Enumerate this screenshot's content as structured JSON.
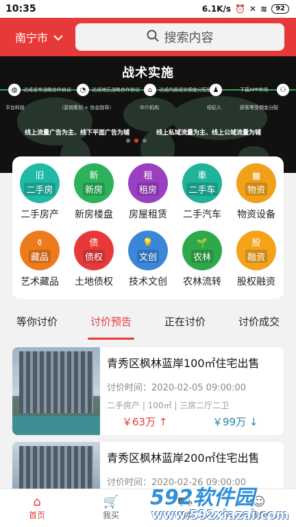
{
  "status": {
    "time": "10:35",
    "speed": "6.1K/s",
    "battery": "92"
  },
  "header": {
    "city": "南宁市",
    "search_placeholder": "搜索内容"
  },
  "banner": {
    "title": "战术实施",
    "nodes": [
      {
        "caption": "达成省市战略合作协议",
        "sub": "平台科技"
      },
      {
        "caption": "达成地区战略合作协议",
        "sub": "（营销策划 + 协会指导）"
      },
      {
        "caption": "达成内部成交佣金分配协议",
        "sub": "中介机构"
      },
      {
        "caption": "",
        "sub": "经纪人"
      },
      {
        "caption": "下载APP市场",
        "sub": "获客等受佣金分配"
      }
    ],
    "slogan_left": "线上流量广告为主、线下平面广告为辅",
    "slogan_right": "线上私域流量为主、线上公域流量为辅"
  },
  "categories": [
    {
      "label": "二手房产",
      "tag": "二手房",
      "glyph": "旧",
      "color": "#20b9a6"
    },
    {
      "label": "新房楼盘",
      "tag": "新房",
      "glyph": "新",
      "color": "#2bb25a"
    },
    {
      "label": "房屋租赁",
      "tag": "租房",
      "glyph": "租",
      "color": "#9a3fc2"
    },
    {
      "label": "二手汽车",
      "tag": "二手车",
      "glyph": "車",
      "color": "#1fb39a"
    },
    {
      "label": "物资设备",
      "tag": "物资",
      "glyph": "▦",
      "color": "#f0a019"
    },
    {
      "label": "艺术藏品",
      "tag": "藏品",
      "glyph": "⚱",
      "color": "#ee7a1e"
    },
    {
      "label": "土地债权",
      "tag": "债权",
      "glyph": "债",
      "color": "#e8393a"
    },
    {
      "label": "技术文创",
      "tag": "文创",
      "glyph": "💡",
      "color": "#3b86d8"
    },
    {
      "label": "农林流转",
      "tag": "农林",
      "glyph": "🌱",
      "color": "#2fa84a"
    },
    {
      "label": "股权融资",
      "tag": "融资",
      "glyph": "股",
      "color": "#f4a21a"
    }
  ],
  "tabs": [
    "等你讨价",
    "讨价预告",
    "正在讨价",
    "讨价成交"
  ],
  "active_tab": "讨价预告",
  "listings": [
    {
      "title": "青秀区枫林蓝岸100㎡住宅出售",
      "time": "讨价时间：2020-02-05 09:00:00",
      "meta": "二手房产 | 100㎡ | 三房二厅二卫",
      "price_up": "￥63万 ↑",
      "price_down": "￥99万 ↓"
    },
    {
      "title": "青秀区枫林蓝岸200㎡住宅出售",
      "time": "讨价时间：2020-02-26 09:00:00"
    }
  ],
  "nav": [
    {
      "label": "首页",
      "icon": "home-icon"
    },
    {
      "label": "我买",
      "icon": "cart-icon"
    },
    {
      "label": "我卖",
      "icon": "sell-icon"
    },
    {
      "label": "我的",
      "icon": "user-icon"
    }
  ],
  "watermark": {
    "logo": "592软件园",
    "url": "www.592xiazai.com"
  },
  "colors": {
    "primary": "#e8393a",
    "price_up": "#e8393a",
    "price_down": "#1f8aa6"
  }
}
